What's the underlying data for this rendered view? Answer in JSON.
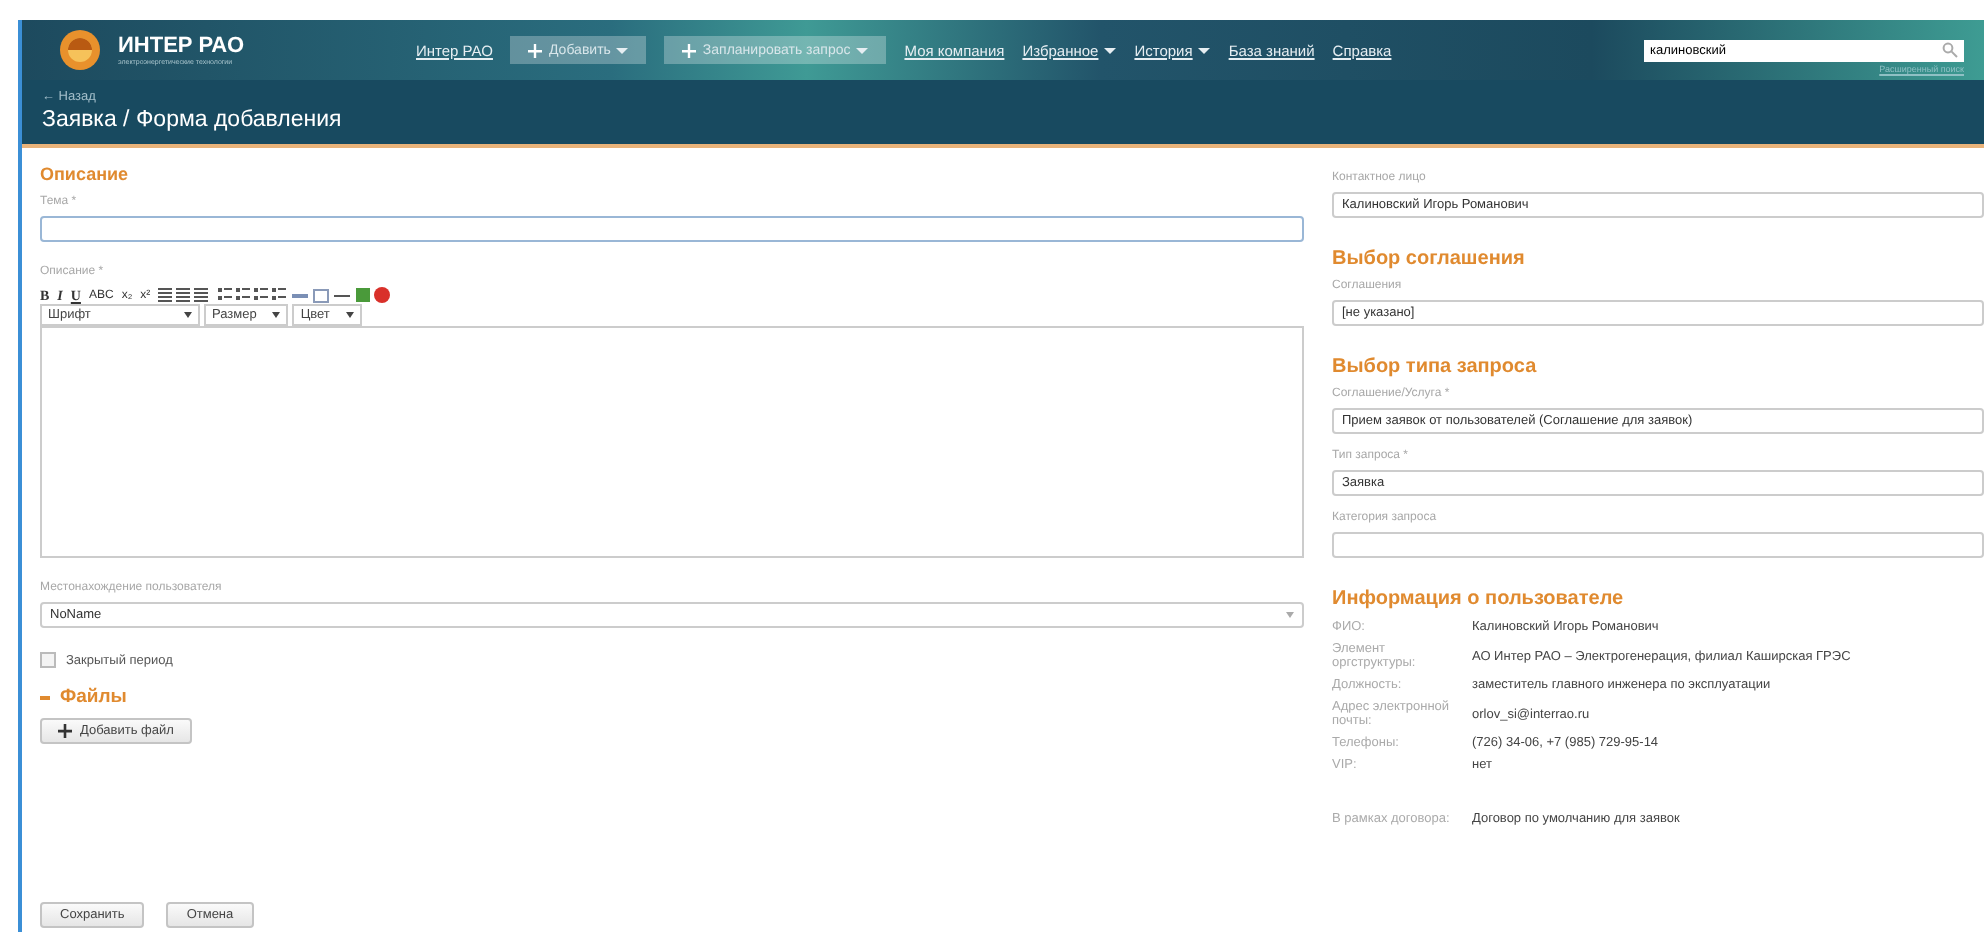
{
  "header": {
    "logo_text": "ИНТЕР РАО",
    "logo_subtext": "электроэнергетические технологии",
    "nav": [
      {
        "label": "Интер РАО",
        "kind": "link"
      },
      {
        "label": "Добавить",
        "kind": "button"
      },
      {
        "label": "Запланировать запрос",
        "kind": "button"
      },
      {
        "label": "Моя компания",
        "kind": "link"
      },
      {
        "label": "Избранное",
        "kind": "menu"
      },
      {
        "label": "История",
        "kind": "menu"
      },
      {
        "label": "База знаний",
        "kind": "link"
      },
      {
        "label": "Справка",
        "kind": "link"
      }
    ],
    "search": {
      "value": "калиновский",
      "advanced_link": "Расширенный поиск"
    }
  },
  "subheader": {
    "back_link": "← Назад",
    "title": "Заявка / Форма добавления"
  },
  "left": {
    "section_title": "Описание",
    "subject_label": "Тема *",
    "description_label": "Описание *",
    "editor": {
      "format_buttons": [
        "B",
        "I",
        "U",
        "ABC",
        "x₂",
        "x²"
      ],
      "dropdowns": [
        "Шрифт",
        "Размер",
        "Цвет"
      ]
    },
    "location_label": "Местонахождение пользователя",
    "location_value": "NoName",
    "closed_period": {
      "label": "Закрытый период",
      "checked": false
    },
    "files": {
      "title": "Файлы",
      "expanded": true,
      "add_button": "Добавить файл"
    },
    "buttons": [
      "Сохранить",
      "Отмена"
    ]
  },
  "right": {
    "contact_label": "Контактное лицо",
    "contact_value": "Калиновский Игорь Романович",
    "agreement_title": "Выбор соглашения",
    "agreement_label": "Соглашения",
    "agreement_value": "[не указано]",
    "request_type_title": "Выбор типа запроса",
    "fields": [
      {
        "label": "Соглашение/Услуга *",
        "value": "Прием заявок от пользователей (Соглашение для заявок)"
      },
      {
        "label": "Тип запроса *",
        "value": "Заявка"
      },
      {
        "label": "Категория запроса"
      }
    ],
    "user_info_title": "Информация о пользователе",
    "user_info": [
      {
        "label": "ФИО:",
        "value": "Калиновский Игорь Романович"
      },
      {
        "label": "Элемент оргструктуры:",
        "value": "АО Интер РАО – Электрогенерация, филиал Каширская ГРЭС"
      },
      {
        "label": "Должность:",
        "value": "заместитель главного инженера по эксплуатации"
      },
      {
        "label": "Адрес электронной почты:",
        "value": "orlov_si@interrao.ru"
      },
      {
        "label": "Телефоны:",
        "value": "(726) 34-06, +7 (985) 729-95-14"
      },
      {
        "label": "VIP:",
        "value": "нет"
      }
    ],
    "contract_label": "В рамках договора:",
    "contract_value": "Договор по умолчанию для заявок"
  }
}
